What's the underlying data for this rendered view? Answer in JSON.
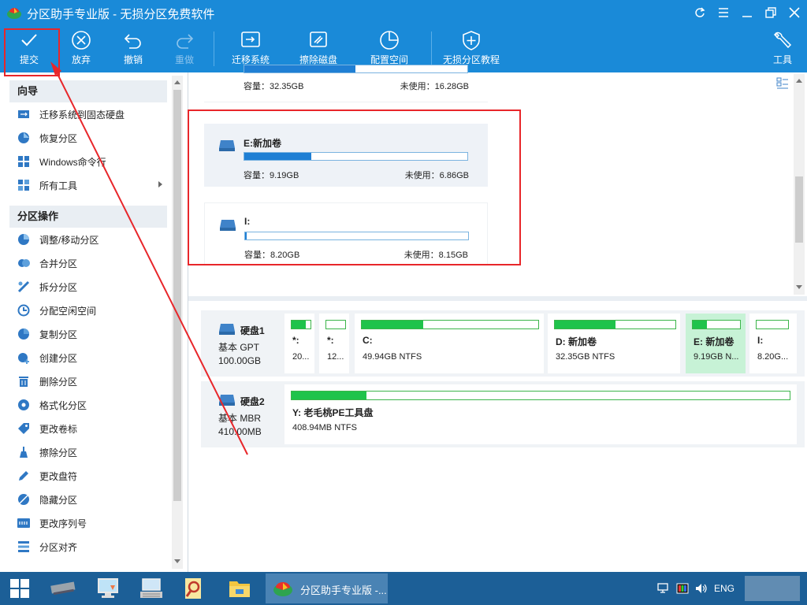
{
  "window": {
    "title": "分区助手专业版 - 无损分区免费软件",
    "controls": [
      "refresh-icon",
      "menu-icon",
      "minimize-icon",
      "restore-icon",
      "close-icon"
    ]
  },
  "toolbar": {
    "commit": "提交",
    "discard": "放弃",
    "undo": "撤销",
    "redo": "重做",
    "migrate": "迁移系统",
    "wipe": "擦除磁盘",
    "allocate": "配置空间",
    "tutorial": "无损分区教程",
    "tools": "工具"
  },
  "sidebar": {
    "wizard_header": "向导",
    "wizard_items": [
      {
        "label": "迁移系统到固态硬盘",
        "icon": "migrate-ssd-icon"
      },
      {
        "label": "恢复分区",
        "icon": "recover-icon"
      },
      {
        "label": "Windows命令行",
        "icon": "windows-icon"
      },
      {
        "label": "所有工具",
        "icon": "all-tools-icon"
      }
    ],
    "ops_header": "分区操作",
    "ops_items": [
      {
        "label": "调整/移动分区",
        "icon": "resize-icon"
      },
      {
        "label": "合并分区",
        "icon": "merge-icon"
      },
      {
        "label": "拆分分区",
        "icon": "split-icon"
      },
      {
        "label": "分配空闲空间",
        "icon": "allocate-icon"
      },
      {
        "label": "复制分区",
        "icon": "copy-icon"
      },
      {
        "label": "创建分区",
        "icon": "create-icon"
      },
      {
        "label": "删除分区",
        "icon": "delete-icon"
      },
      {
        "label": "格式化分区",
        "icon": "format-icon"
      },
      {
        "label": "更改卷标",
        "icon": "label-icon"
      },
      {
        "label": "擦除分区",
        "icon": "wipe-icon"
      },
      {
        "label": "更改盘符",
        "icon": "drive-letter-icon"
      },
      {
        "label": "隐藏分区",
        "icon": "hide-icon"
      },
      {
        "label": "更改序列号",
        "icon": "serial-icon"
      },
      {
        "label": "分区对齐",
        "icon": "align-icon"
      }
    ]
  },
  "partition_cards": [
    {
      "name": "",
      "capacity": "容量：32.35GB",
      "unused": "未使用：16.28GB",
      "used_fraction": 0.497
    },
    {
      "name": "E:新加卷",
      "capacity": "容量：9.19GB",
      "unused": "未使用：6.86GB",
      "used_fraction": 0.3
    },
    {
      "name": "I:",
      "capacity": "容量：8.20GB",
      "unused": "未使用：8.15GB",
      "used_fraction": 0.006
    }
  ],
  "disks": [
    {
      "name": "硬盘1",
      "type": "基本 GPT",
      "size": "100.00GB",
      "partitions": [
        {
          "label": "*:",
          "info": "20...",
          "used_fraction": 0.75
        },
        {
          "label": "*:",
          "info": "12...",
          "used_fraction": 0.0
        },
        {
          "label": "C:",
          "info": "49.94GB NTFS",
          "used_fraction": 0.35
        },
        {
          "label": "D: 新加卷",
          "info": "32.35GB NTFS",
          "used_fraction": 0.5
        },
        {
          "label": "E: 新加卷",
          "info": "9.19GB N...",
          "used_fraction": 0.3,
          "selected": true
        },
        {
          "label": "I:",
          "info": "8.20G...",
          "used_fraction": 0.0
        }
      ]
    },
    {
      "name": "硬盘2",
      "type": "基本 MBR",
      "size": "410.00MB",
      "partitions": [
        {
          "label": "Y: 老毛桃PE工具盘",
          "info": "408.94MB NTFS",
          "used_fraction": 0.15
        }
      ]
    }
  ],
  "taskbar": {
    "active_app": "分区助手专业版 -...",
    "language": "ENG"
  },
  "colors": {
    "accent": "#1a8ad8",
    "taskbar": "#1c5f97",
    "partition_bar": "#1f7fd4",
    "disk_bar": "#1fc34b",
    "selected_partition": "#c7f2d6",
    "annotation": "#e8262a"
  }
}
